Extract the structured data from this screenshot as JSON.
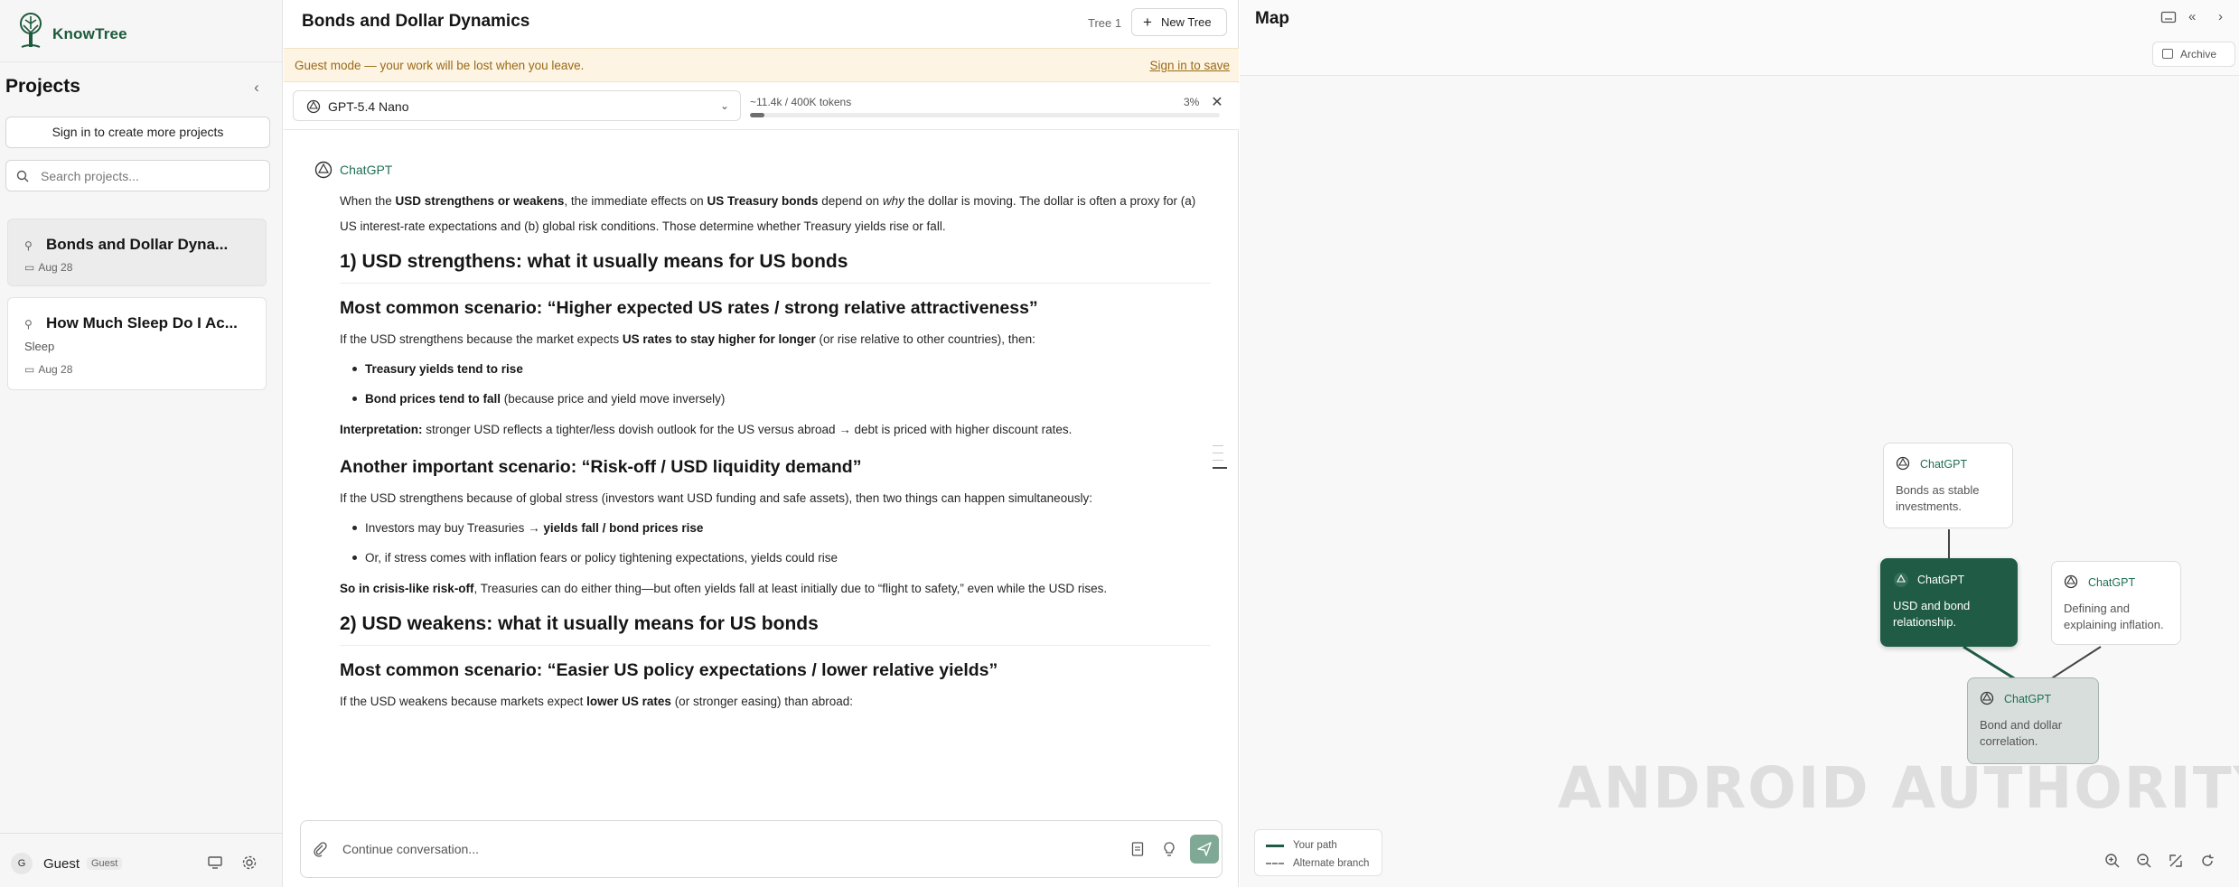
{
  "app": {
    "name": "KnowTree"
  },
  "sidebar": {
    "title": "Projects",
    "signin_button": "Sign in to create more projects",
    "search_placeholder": "Search projects...",
    "projects": [
      {
        "title": "Bonds and Dollar Dyna...",
        "date": "Aug 28",
        "active": true
      },
      {
        "title": "How Much Sleep Do I Ac...",
        "subtitle": "Sleep",
        "date": "Aug 28",
        "active": false
      }
    ],
    "user": {
      "initial": "G",
      "name": "Guest",
      "badge": "Guest"
    }
  },
  "chat": {
    "title": "Bonds and Dollar Dynamics",
    "tree_label": "Tree 1",
    "new_tree_label": "New Tree",
    "guest_banner": "Guest mode — your work will be lost when you leave.",
    "guest_signin": "Sign in to save",
    "model": "GPT-5.4 Nano",
    "tokens": "~11.4k / 400K tokens",
    "token_percent": "3%",
    "token_fraction": 0.03,
    "message_author": "ChatGPT",
    "composer_placeholder": "Continue conversation..."
  },
  "message": {
    "p1_a": "When the ",
    "p1_b": "USD strengthens or weakens",
    "p1_c": ", the immediate effects on ",
    "p1_d": "US Treasury bonds",
    "p1_e": " depend on ",
    "p1_f": "why",
    "p1_g": " the dollar is moving. The dollar is often a proxy for (a) US interest-rate expectations and (b) global risk conditions. Those determine whether Treasury yields rise or fall.",
    "h1": "1) USD strengthens: what it usually means for US bonds",
    "h1a": "Most common scenario: “Higher expected US rates / strong relative attractiveness”",
    "p2_a": "If the USD strengthens because the market expects ",
    "p2_b": "US rates to stay higher for longer",
    "p2_c": " (or rise relative to other countries), then:",
    "li1": "Treasury yields tend to rise",
    "li2_a": "Bond prices tend to fall",
    "li2_b": " (because price and yield move inversely)",
    "p3_a": "Interpretation:",
    "p3_b": " stronger USD reflects a tighter/less dovish outlook for the US versus abroad → debt is priced with higher discount rates.",
    "h1b": "Another important scenario: “Risk-off / USD liquidity demand”",
    "p4": "If the USD strengthens because of global stress (investors want USD funding and safe assets), then two things can happen simultaneously:",
    "li3_a": "Investors may buy Treasuries → ",
    "li3_b": "yields fall / bond prices rise",
    "li4": "Or, if stress comes with inflation fears or policy tightening expectations, yields could rise",
    "p5_a": "So in crisis-like risk-off",
    "p5_b": ", Treasuries can do either thing—but often yields fall at least initially due to “flight to safety,” even while the USD rises.",
    "h2": "2) USD weakens: what it usually means for US bonds",
    "h2a": "Most common scenario: “Easier US policy expectations / lower relative yields”",
    "p6_a": "If the USD weakens because markets expect ",
    "p6_b": "lower US rates",
    "p6_c": " (or stronger easing) than abroad:"
  },
  "map": {
    "title": "Map",
    "archive_label": "Archive",
    "nodes": [
      {
        "author": "ChatGPT",
        "text": "Bonds as stable investments."
      },
      {
        "author": "ChatGPT",
        "text": "USD and bond relationship."
      },
      {
        "author": "ChatGPT",
        "text": "Defining and explaining inflation."
      },
      {
        "author": "ChatGPT",
        "text": "Bond and dollar correlation."
      }
    ],
    "legend": {
      "your_path": "Your path",
      "alternate_branch": "Alternate branch"
    },
    "watermark": "ANDROID AUTHORITY"
  },
  "colors": {
    "brand_green": "#1f5b45",
    "banner_bg": "#fdf4e3",
    "banner_text": "#9a6a18",
    "send_button": "#7fa994"
  }
}
